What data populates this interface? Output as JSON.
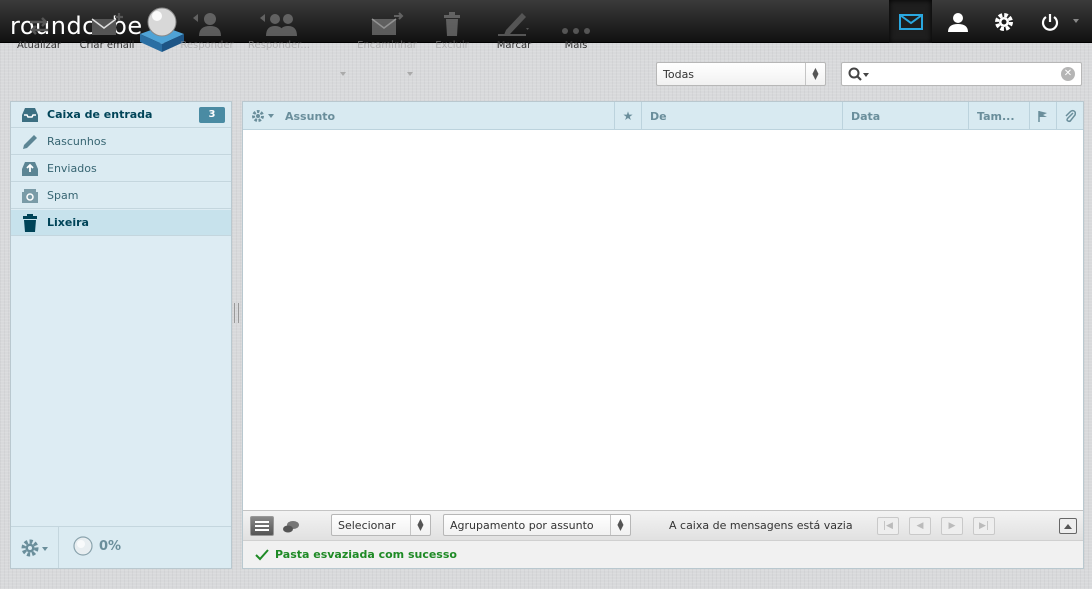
{
  "app": {
    "logo_text": "roundcube"
  },
  "topnav": {
    "mail_icon": "envelope-icon",
    "contacts_icon": "person-icon",
    "settings_icon": "gear-icon",
    "logout_icon": "power-icon"
  },
  "toolbar": {
    "refresh_label": "Atualizar",
    "compose_label": "Criar email",
    "reply_label": "Responder",
    "reply_all_label": "Responder...",
    "forward_label": "Encaminhar",
    "delete_label": "Excluir",
    "mark_label": "Marcar",
    "more_label": "Mais"
  },
  "filter": {
    "selected": "Todas"
  },
  "search": {
    "value": "",
    "placeholder": ""
  },
  "folders": [
    {
      "label": "Caixa de entrada",
      "unread": "3",
      "icon": "inbox-icon"
    },
    {
      "label": "Rascunhos",
      "icon": "pencil-icon"
    },
    {
      "label": "Enviados",
      "icon": "sent-icon"
    },
    {
      "label": "Spam",
      "icon": "spam-icon"
    },
    {
      "label": "Lixeira",
      "icon": "trash-icon"
    }
  ],
  "quota": {
    "text": "0%"
  },
  "list_columns": {
    "subject": "Assunto",
    "from": "De",
    "date": "Data",
    "size": "Tam..."
  },
  "list_footer": {
    "select_label": "Selecionar",
    "threads_label": "Agrupamento por assunto",
    "count_text": "A caixa de mensagens está vazia"
  },
  "status_message": "Pasta esvaziada com sucesso",
  "colors": {
    "topbar": "#1b1b1b",
    "accent": "#2aa8e0",
    "panel": "#ddecf3",
    "success": "#1e8a25"
  }
}
